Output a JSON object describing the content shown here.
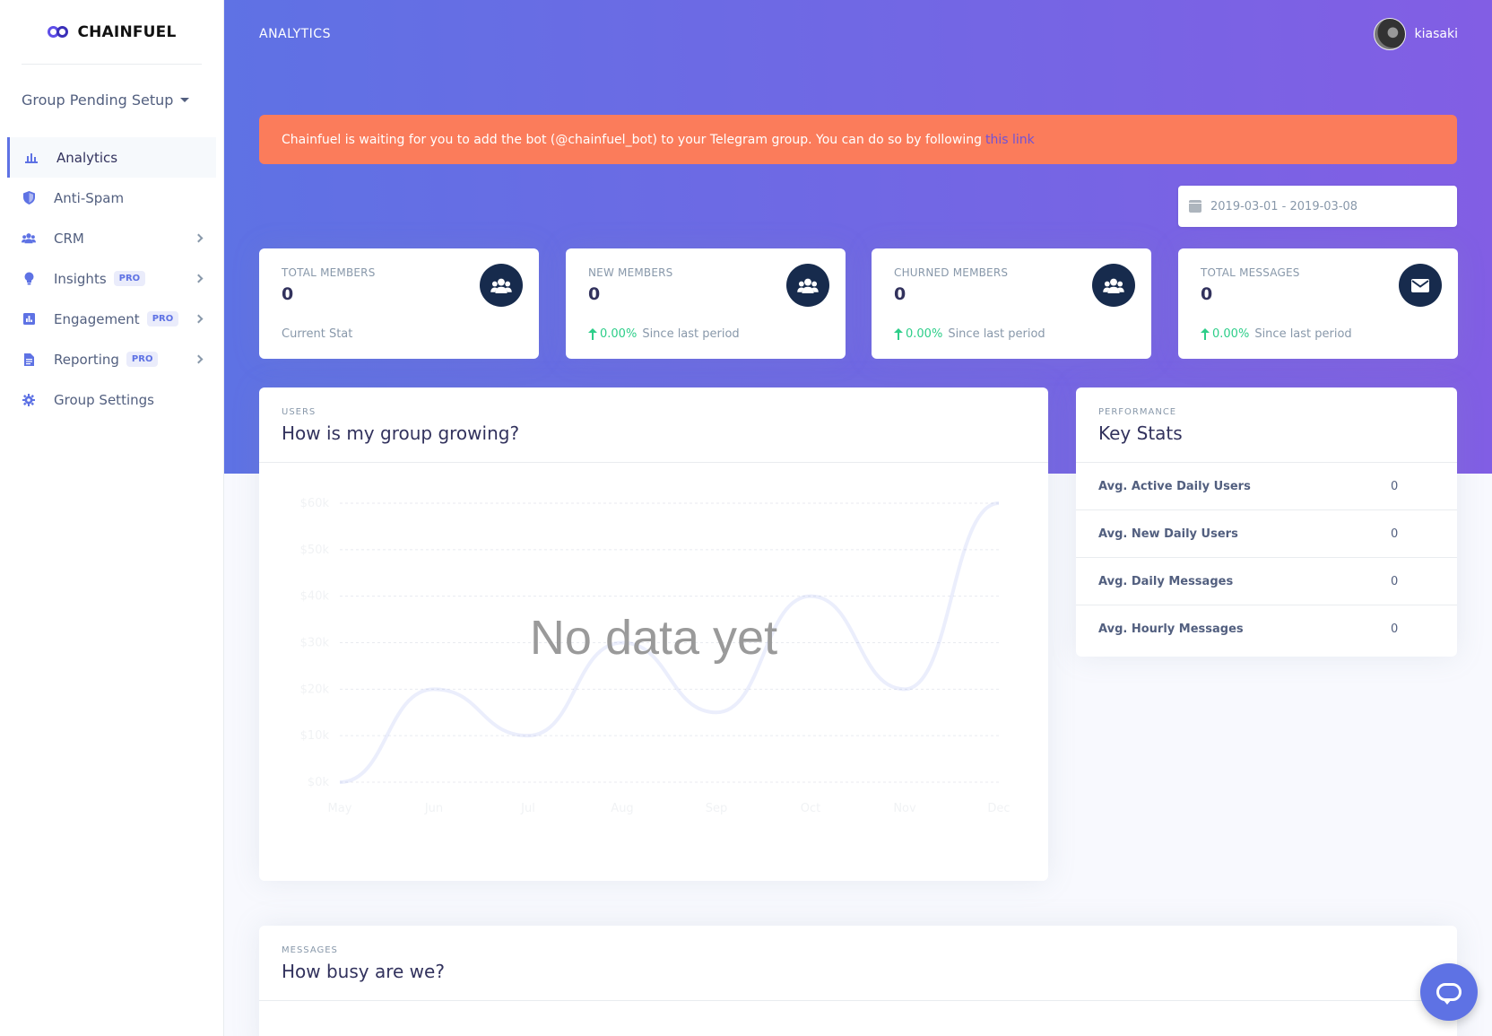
{
  "brand": {
    "name": "CHAINFUEL",
    "logo_icon": "chainfuel-logo-icon"
  },
  "group_selector": {
    "label": "Group Pending Setup"
  },
  "sidebar": {
    "items": [
      {
        "label": "Analytics",
        "icon": "bar-chart-icon",
        "active": true,
        "pro": false,
        "chevron": false
      },
      {
        "label": "Anti-Spam",
        "icon": "shield-icon",
        "active": false,
        "pro": false,
        "chevron": false
      },
      {
        "label": "CRM",
        "icon": "users-icon",
        "active": false,
        "pro": false,
        "chevron": true
      },
      {
        "label": "Insights",
        "icon": "lightbulb-icon",
        "active": false,
        "pro": true,
        "pro_label": "PRO",
        "chevron": true
      },
      {
        "label": "Engagement",
        "icon": "poll-icon",
        "active": false,
        "pro": true,
        "pro_label": "PRO",
        "chevron": true
      },
      {
        "label": "Reporting",
        "icon": "document-icon",
        "active": false,
        "pro": true,
        "pro_label": "PRO",
        "chevron": true
      },
      {
        "label": "Group Settings",
        "icon": "gear-icon",
        "active": false,
        "pro": false,
        "chevron": false
      }
    ]
  },
  "header": {
    "title": "ANALYTICS",
    "username": "kiasaki"
  },
  "alert": {
    "text": "Chainfuel is waiting for you to add the bot (@chainfuel_bot) to your Telegram group. You can do so by following",
    "link_text": "this link"
  },
  "date_range": {
    "value": "2019-03-01 - 2019-03-08"
  },
  "stats": [
    {
      "title": "TOTAL MEMBERS",
      "value": "0",
      "footer": "Current Stat",
      "pct": null,
      "icon": "users-icon"
    },
    {
      "title": "NEW MEMBERS",
      "value": "0",
      "pct": "0.00%",
      "footer": "Since last period",
      "icon": "users-icon"
    },
    {
      "title": "CHURNED MEMBERS",
      "value": "0",
      "pct": "0.00%",
      "footer": "Since last period",
      "icon": "users-icon"
    },
    {
      "title": "TOTAL MESSAGES",
      "value": "0",
      "pct": "0.00%",
      "footer": "Since last period",
      "icon": "envelope-icon"
    }
  ],
  "growth_panel": {
    "kicker": "USERS",
    "title": "How is my group growing?",
    "overlay": "No data yet"
  },
  "chart_data": {
    "type": "line",
    "categories": [
      "May",
      "Jun",
      "Jul",
      "Aug",
      "Sep",
      "Oct",
      "Nov",
      "Dec"
    ],
    "values": [
      0,
      20,
      10,
      30,
      15,
      40,
      20,
      60
    ],
    "y_tick_labels": [
      "$0k",
      "$10k",
      "$20k",
      "$30k",
      "$40k",
      "$50k",
      "$60k"
    ],
    "ylim": [
      0,
      60
    ],
    "grid": true,
    "color": "#5e72e4"
  },
  "key_stats_panel": {
    "kicker": "PERFORMANCE",
    "title": "Key Stats",
    "rows": [
      {
        "label": "Avg. Active Daily Users",
        "value": "0"
      },
      {
        "label": "Avg. New Daily Users",
        "value": "0"
      },
      {
        "label": "Avg. Daily Messages",
        "value": "0"
      },
      {
        "label": "Avg. Hourly Messages",
        "value": "0"
      }
    ]
  },
  "messages_panel": {
    "kicker": "MESSAGES",
    "title": "How busy are we?"
  },
  "chat_button": {
    "icon": "chat-bubbles-icon"
  },
  "colors": {
    "accent": "#5e72e4",
    "gradient_end": "#825ee4",
    "alert": "#fb7c5b",
    "positive": "#2dce89",
    "dark": "#172b4d"
  }
}
